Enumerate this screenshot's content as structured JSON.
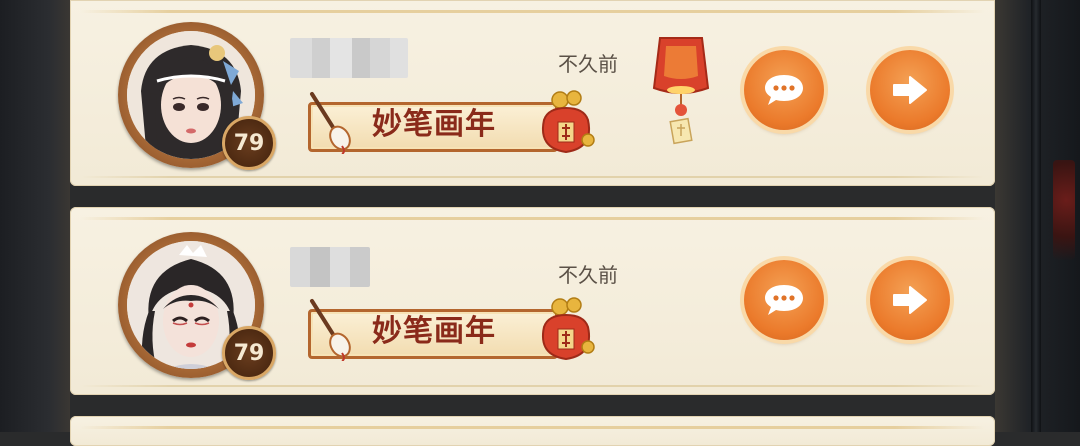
{
  "friend_list": {
    "rows": [
      {
        "level": "79",
        "title": "妙笔画年",
        "last_online": "不久前",
        "has_lantern": true
      },
      {
        "level": "79",
        "title": "妙笔画年",
        "last_online": "不久前",
        "has_lantern": false
      }
    ]
  },
  "icons": {
    "chat": "speech-bubble-icon",
    "visit": "arrow-right-icon",
    "lantern": "sky-lantern-icon",
    "title_brush": "brush-icon",
    "title_bag": "lucky-bag-icon"
  },
  "colors": {
    "card_bg": "#f4ecda",
    "button_orange": "#eb7a2b",
    "title_text": "#8a2a1a",
    "avatar_frame": "#a86936"
  }
}
